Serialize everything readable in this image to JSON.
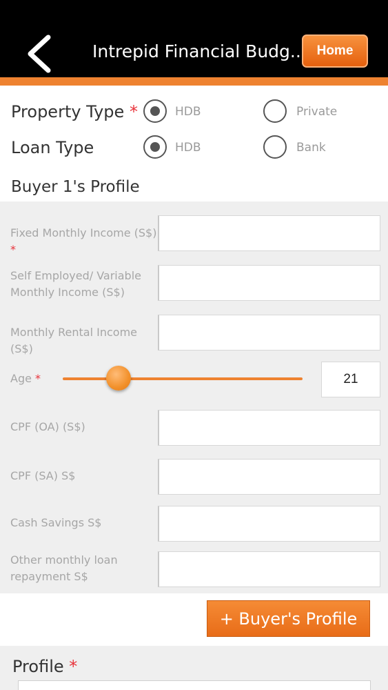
{
  "nav": {
    "title": "Intrepid Financial Budg...",
    "home_label": "Home"
  },
  "property_type": {
    "label": "Property Type",
    "required_mark": "*",
    "options": [
      "HDB",
      "Private"
    ],
    "selected": "HDB"
  },
  "loan_type": {
    "label": "Loan Type",
    "options": [
      "HDB",
      "Bank"
    ],
    "selected": "HDB"
  },
  "buyer_section": {
    "title": "Buyer 1's Profile"
  },
  "fields": {
    "fixed_income": {
      "label": "Fixed Monthly Income (S$)",
      "required_mark": "*",
      "value": ""
    },
    "variable_income": {
      "label": "Self Employed/ Variable Monthly Income (S$)",
      "value": ""
    },
    "rental_income": {
      "label": "Monthly Rental Income (S$)",
      "value": ""
    },
    "age": {
      "label": "Age",
      "required_mark": "*",
      "value": "21"
    },
    "cpf_oa": {
      "label": "CPF (OA) (S$)",
      "value": ""
    },
    "cpf_sa": {
      "label": "CPF (SA) S$",
      "value": ""
    },
    "cash_savings": {
      "label": "Cash Savings S$",
      "value": ""
    },
    "other_loan": {
      "label": "Other monthly loan repayment S$",
      "value": ""
    }
  },
  "add_buyer_label": "+ Buyer's Profile",
  "profile": {
    "label": "Profile",
    "required_mark": "*"
  },
  "colors": {
    "accent": "#ee8230",
    "nav_bg": "#000000",
    "required": "#e8323a"
  },
  "icons": {
    "back": "chevron-left-icon"
  }
}
